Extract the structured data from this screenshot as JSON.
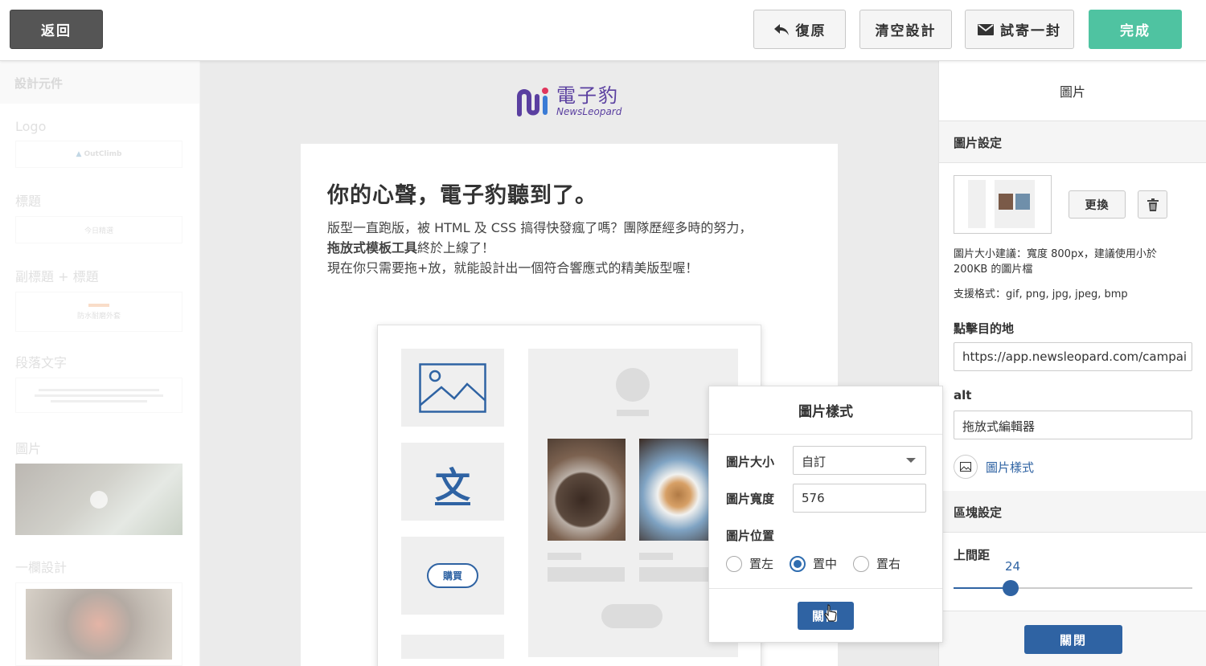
{
  "toolbar": {
    "back": "返回",
    "restore": "復原",
    "clear": "清空設計",
    "test_send": "試寄一封",
    "done": "完成"
  },
  "sidebar": {
    "header": "設計元件",
    "components": [
      {
        "label": "Logo",
        "preview": "OutClimb"
      },
      {
        "label": "標題",
        "preview": "今日精選"
      },
      {
        "label": "副標題 + 標題",
        "preview": "防水耐磨外套"
      },
      {
        "label": "段落文字",
        "preview": ""
      },
      {
        "label": "圖片",
        "preview": ""
      },
      {
        "label": "一欄設計",
        "preview": ""
      }
    ]
  },
  "canvas": {
    "logo_cn": "電子豹",
    "logo_en": "NewsLeopard",
    "headline": "你的心聲，電子豹聽到了。",
    "para_1": "版型一直跑版，被 HTML 及 CSS 搞得快發瘋了嗎？團隊歷經多時的努力，",
    "para_2_bold": "拖放式模板工具",
    "para_2_rest": "終於上線了！",
    "para_3": "現在你只需要拖+放，就能設計出一個符合響應式的精美版型喔！",
    "mock_char": "文",
    "mock_buy": "購買"
  },
  "popover": {
    "title": "圖片樣式",
    "size_label": "圖片大小",
    "size_value": "自訂",
    "width_label": "圖片寬度",
    "width_value": "576",
    "position_label": "圖片位置",
    "options": [
      "置左",
      "置中",
      "置右"
    ],
    "selected": "置中",
    "close": "關閉"
  },
  "right_panel": {
    "title": "圖片",
    "image_settings": "圖片設定",
    "replace": "更換",
    "size_hint": "圖片大小建議：寬度 800px，建議使用小於 200KB 的圖片檔",
    "formats": "支援格式：gif, png, jpg, jpeg, bmp",
    "link_label": "點擊目的地",
    "link_value": "https://app.newsleopard.com/campai",
    "alt_label": "alt",
    "alt_value": "拖放式編輯器",
    "image_style_link": "圖片樣式",
    "block_settings": "區塊設定",
    "top_spacing_label": "上間距",
    "top_spacing_value": "24",
    "top_spacing_fraction": 0.24,
    "close": "關閉"
  },
  "colors": {
    "accent_green": "#4fc3a1",
    "primary_blue": "#2f63a3",
    "brand_purple": "#5a3fa0"
  }
}
